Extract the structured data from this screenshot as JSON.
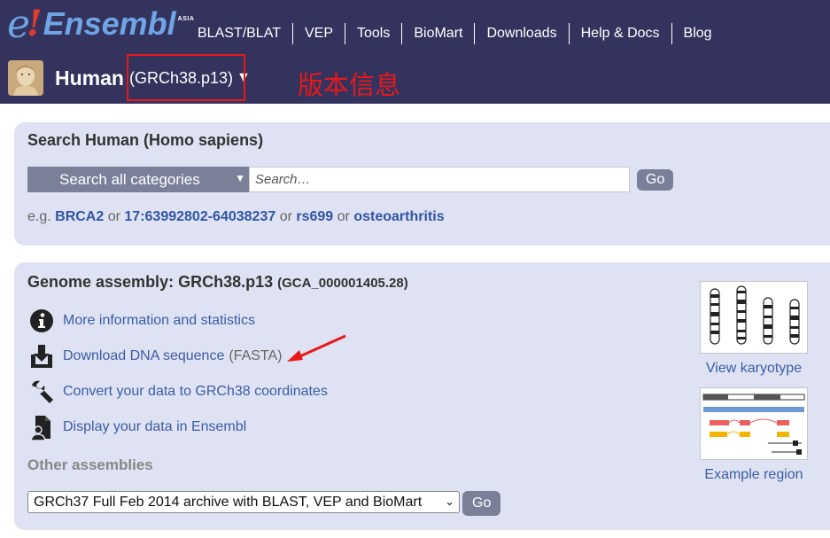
{
  "logo": {
    "e": "e",
    "bang": "!",
    "text": "Ensembl",
    "asia": "ASIA"
  },
  "top_nav": [
    "BLAST/BLAT",
    "VEP",
    "Tools",
    "BioMart",
    "Downloads",
    "Help & Docs",
    "Blog"
  ],
  "species": {
    "name": "Human",
    "assembly": "(GRCh38.p13)",
    "dropdown": "▼"
  },
  "annotation": {
    "label": "版本信息",
    "color": "#e81818"
  },
  "search": {
    "title": "Search Human (Homo sapiens)",
    "category": "Search all categories",
    "category_arrow": "▼",
    "placeholder": "Search…",
    "go_label": "Go",
    "examples_prefix": "e.g.",
    "examples": [
      "BRCA2",
      "17:63992802-64038237",
      "rs699",
      "osteoarthritis"
    ],
    "or_word": "or"
  },
  "genome": {
    "title": "Genome assembly: GRCh38.p13",
    "accession": "(GCA_000001405.28)",
    "links": [
      {
        "label": "More information and statistics",
        "suffix": "",
        "icon": "info-icon"
      },
      {
        "label": "Download DNA sequence",
        "suffix": "(FASTA)",
        "icon": "download-icon"
      },
      {
        "label": "Convert your data to GRCh38 coordinates",
        "suffix": "",
        "icon": "wrench-icon"
      },
      {
        "label": "Display your data in Ensembl",
        "suffix": "",
        "icon": "user-data-icon"
      }
    ],
    "other_heading": "Other assemblies",
    "archive_option": "GRCh37 Full Feb 2014 archive with BLAST, VEP and BioMart",
    "archive_go": "Go",
    "karyotype_caption": "View karyotype",
    "region_caption": "Example region"
  },
  "colors": {
    "header_bg": "#33335e",
    "panel_bg": "#dfe2f2",
    "button_bg": "#7b8099",
    "link": "#3a5da6"
  }
}
